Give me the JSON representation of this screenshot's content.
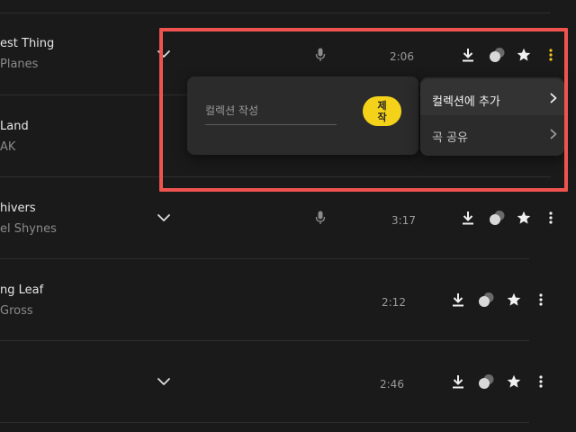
{
  "tracks": [
    {
      "title": "est Thing",
      "artist": "Planes",
      "time": "2:06",
      "has_mic": true
    },
    {
      "title": "Land",
      "artist": "AK",
      "time": "",
      "has_mic": false
    },
    {
      "title": "hivers",
      "artist": "el Shynes",
      "time": "3:17",
      "has_mic": true
    },
    {
      "title": "ng Leaf",
      "artist": "Gross",
      "time": "2:12",
      "has_mic": false
    },
    {
      "title": "",
      "artist": "",
      "time": "2:46",
      "has_mic": false
    }
  ],
  "popup": {
    "create": {
      "placeholder": "컬렉션 작성",
      "button_label": "제작"
    },
    "menu": [
      {
        "label": "컬렉션에 추가",
        "active": true
      },
      {
        "label": "곡 공유",
        "active": false
      }
    ]
  },
  "icons": {
    "expand": "chevron-down-icon",
    "mic": "mic-icon",
    "download": "download-icon",
    "mix": "mix-icon",
    "favorite": "star-icon",
    "more": "more-vertical-icon",
    "submenu": "chevron-right-icon"
  },
  "colors": {
    "background": "#1a1a1a",
    "accent_button": "#f5d21a",
    "highlight_border": "#ef5350",
    "popup_bg": "#2b2b2b",
    "more_active": "#f5c518"
  }
}
